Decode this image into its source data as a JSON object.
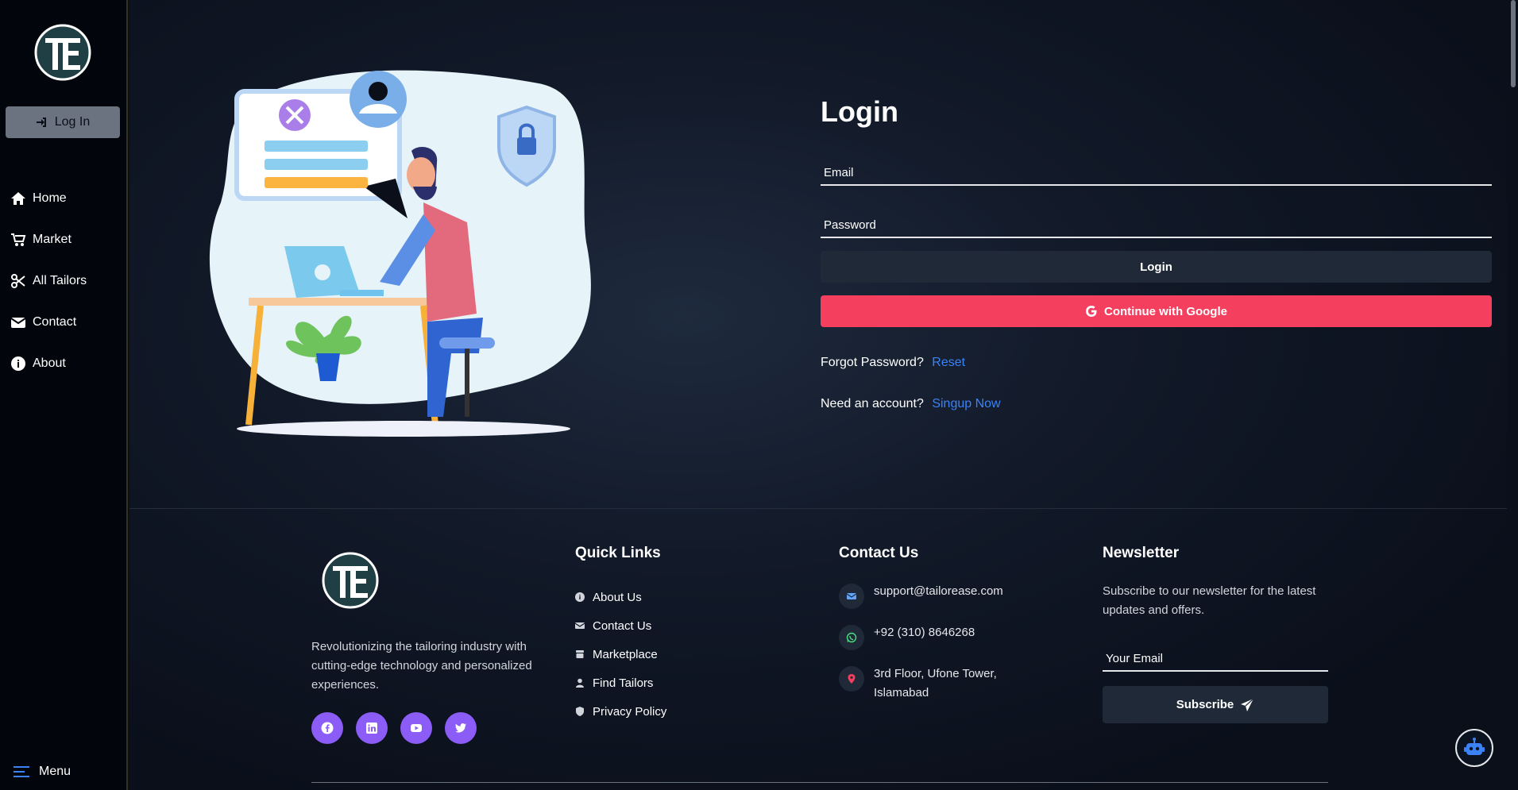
{
  "sidebar": {
    "logo_alt": "TE",
    "login_label": "Log In",
    "items": [
      {
        "label": "Home",
        "icon": "home-icon"
      },
      {
        "label": "Market",
        "icon": "cart-icon"
      },
      {
        "label": "All Tailors",
        "icon": "scissors-icon"
      },
      {
        "label": "Contact",
        "icon": "envelope-icon"
      },
      {
        "label": "About",
        "icon": "info-icon"
      }
    ],
    "menu_label": "Menu"
  },
  "login": {
    "title": "Login",
    "email_placeholder": "Email",
    "password_placeholder": "Password",
    "login_button": "Login",
    "google_button": "Continue with Google",
    "forgot_text": "Forgot Password?",
    "reset_link": "Reset",
    "need_account_text": "Need an account?",
    "signup_link": "Singup Now"
  },
  "footer": {
    "description": "Revolutionizing the tailoring industry with cutting-edge technology and personalized experiences.",
    "socials": [
      "facebook-icon",
      "linkedin-icon",
      "youtube-icon",
      "twitter-icon"
    ],
    "quick_links_title": "Quick Links",
    "quick_links": [
      {
        "label": "About Us",
        "icon": "info-icon"
      },
      {
        "label": "Contact Us",
        "icon": "envelope-icon"
      },
      {
        "label": "Marketplace",
        "icon": "store-icon"
      },
      {
        "label": "Find Tailors",
        "icon": "user-icon"
      },
      {
        "label": "Privacy Policy",
        "icon": "shield-icon"
      }
    ],
    "contact_title": "Contact Us",
    "contact": {
      "email": "support@tailorease.com",
      "phone": "+92 (310) 8646268",
      "address_line1": "3rd Floor, Ufone Tower,",
      "address_line2": "Islamabad"
    },
    "newsletter_title": "Newsletter",
    "newsletter_desc": "Subscribe to our newsletter for the latest updates and offers.",
    "newsletter_placeholder": "Your Email",
    "subscribe_label": "Subscribe"
  },
  "colors": {
    "accent_red": "#f43f5e",
    "link_blue": "#3b82f6",
    "social_purple": "#8b5cf6"
  }
}
